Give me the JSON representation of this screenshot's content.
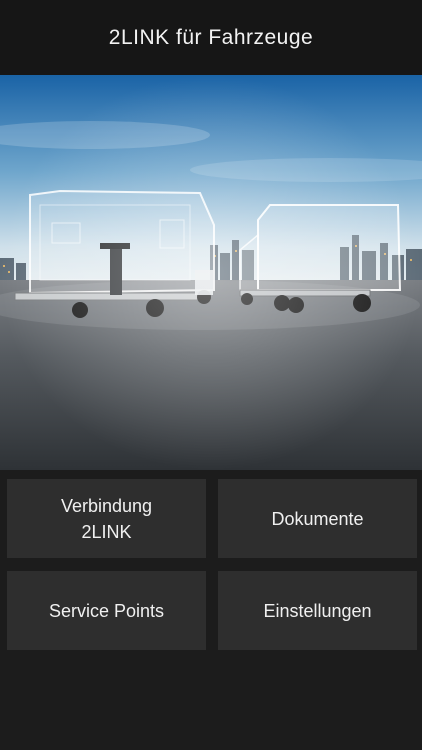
{
  "header": {
    "title": "2LINK für Fahrzeuge"
  },
  "hero": {
    "image": "two-vehicle-chassis-render",
    "sky_top": "#1f6fb0",
    "sky_bottom": "#d9e6ee",
    "ground": "#5b5f63"
  },
  "tiles": [
    {
      "label_line1": "Verbindung",
      "label_line2": "2LINK"
    },
    {
      "label_line1": "Dokumente"
    },
    {
      "label_line1": "Service Points"
    },
    {
      "label_line1": "Einstellungen"
    }
  ]
}
